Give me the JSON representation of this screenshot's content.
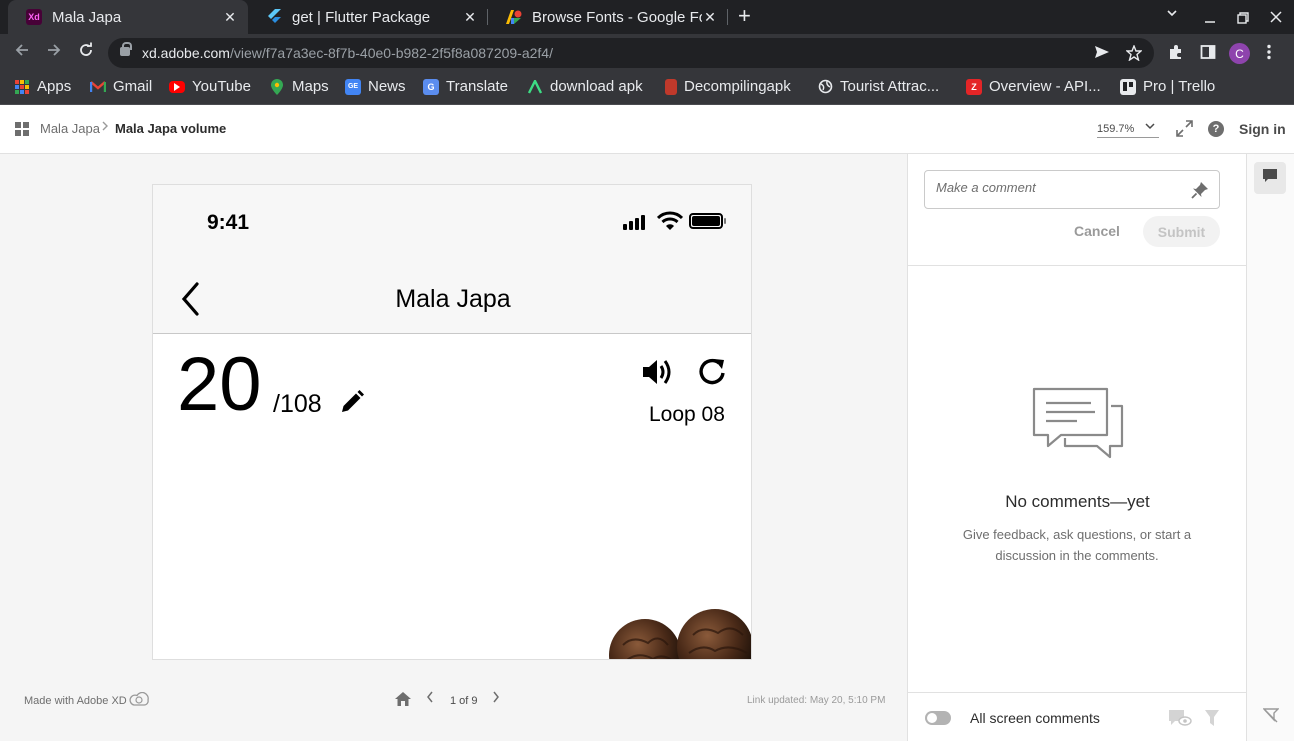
{
  "browser": {
    "tabs": [
      {
        "title": "Mala Japa",
        "favicon": "adobe-xd-icon",
        "favicon_text": "Xd",
        "active": true
      },
      {
        "title": "get | Flutter Package",
        "favicon": "flutter-icon",
        "active": false
      },
      {
        "title": "Browse Fonts - Google Fo",
        "favicon": "google-fonts-icon",
        "active": false
      }
    ],
    "url_host": "xd.adobe.com",
    "url_path": "/view/f7a7a3ec-8f7b-40e0-b982-2f5f8a087209-a2f4/",
    "profile_initial": "C",
    "bookmarks": [
      {
        "label": "Apps",
        "icon": "apps-grid-icon"
      },
      {
        "label": "Gmail",
        "icon": "gmail-icon"
      },
      {
        "label": "YouTube",
        "icon": "youtube-icon"
      },
      {
        "label": "Maps",
        "icon": "maps-icon"
      },
      {
        "label": "News",
        "icon": "news-icon"
      },
      {
        "label": "Translate",
        "icon": "translate-icon"
      },
      {
        "label": "download apk",
        "icon": "apk-icon"
      },
      {
        "label": "Decompilingapk",
        "icon": "decompile-icon"
      },
      {
        "label": "Tourist Attrac...",
        "icon": "globe-icon"
      },
      {
        "label": "Overview - API...",
        "icon": "zoho-icon",
        "icon_text": "Z"
      },
      {
        "label": "Pro | Trello",
        "icon": "trello-icon"
      }
    ]
  },
  "xd": {
    "breadcrumb_root": "Mala Japa",
    "breadcrumb_current": "Mala Japa volume",
    "zoom": "159.7%",
    "help_glyph": "?",
    "signin": "Sign in",
    "made_with": "Made with Adobe XD",
    "pager": "1 of 9",
    "link_updated": "Link updated: May 20, 5:10 PM"
  },
  "artboard": {
    "status_time": "9:41",
    "title": "Mala Japa",
    "count": "20",
    "total": "/108",
    "loop": "Loop 08"
  },
  "comments": {
    "placeholder": "Make a comment",
    "cancel": "Cancel",
    "submit": "Submit",
    "empty_title": "No comments—yet",
    "empty_sub": "Give feedback, ask questions, or start a discussion in the comments.",
    "all_screen": "All screen comments"
  },
  "colors": {
    "chrome_dark": "#202124",
    "chrome_toolbar": "#35363a",
    "profile": "#8e44ad",
    "xd_brand": "#470137"
  }
}
